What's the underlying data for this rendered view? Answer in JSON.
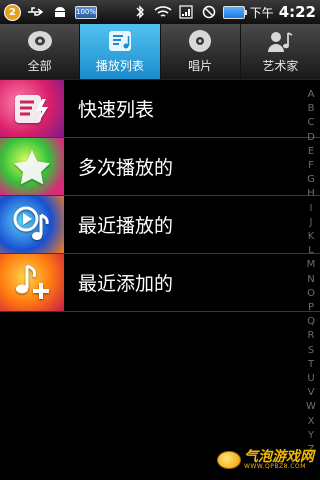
{
  "status_bar": {
    "notification_count": "2",
    "battery_percent": "100%",
    "am_pm": "下午",
    "time": "4:22",
    "icons": [
      "notification-badge",
      "usb-icon",
      "android-icon",
      "battery-percent-icon",
      "bluetooth-icon",
      "wifi-icon",
      "signal-box-icon",
      "do-not-disturb-icon",
      "battery-icon"
    ]
  },
  "tabs": [
    {
      "label": "全部",
      "icon": "disc-icon",
      "active": false
    },
    {
      "label": "播放列表",
      "icon": "playlist-icon",
      "active": true
    },
    {
      "label": "唱片",
      "icon": "album-icon",
      "active": false
    },
    {
      "label": "艺术家",
      "icon": "artist-icon",
      "active": false
    }
  ],
  "playlists": [
    {
      "label": "快速列表",
      "icon": "quick-list-icon"
    },
    {
      "label": "多次播放的",
      "icon": "star-icon"
    },
    {
      "label": "最近播放的",
      "icon": "play-note-icon"
    },
    {
      "label": "最近添加的",
      "icon": "add-note-icon"
    }
  ],
  "alphabet": [
    "A",
    "B",
    "C",
    "D",
    "E",
    "F",
    "G",
    "H",
    "I",
    "J",
    "K",
    "L",
    "M",
    "N",
    "O",
    "P",
    "Q",
    "R",
    "S",
    "T",
    "U",
    "V",
    "W",
    "X",
    "Y",
    "Z"
  ],
  "watermark": {
    "main": "气泡游戏网",
    "sub": "WWW.QPBZ8.COM"
  },
  "colors": {
    "tab_active": "#2aa4e0",
    "background": "#000000",
    "alpha_text": "#6e6e6e"
  }
}
